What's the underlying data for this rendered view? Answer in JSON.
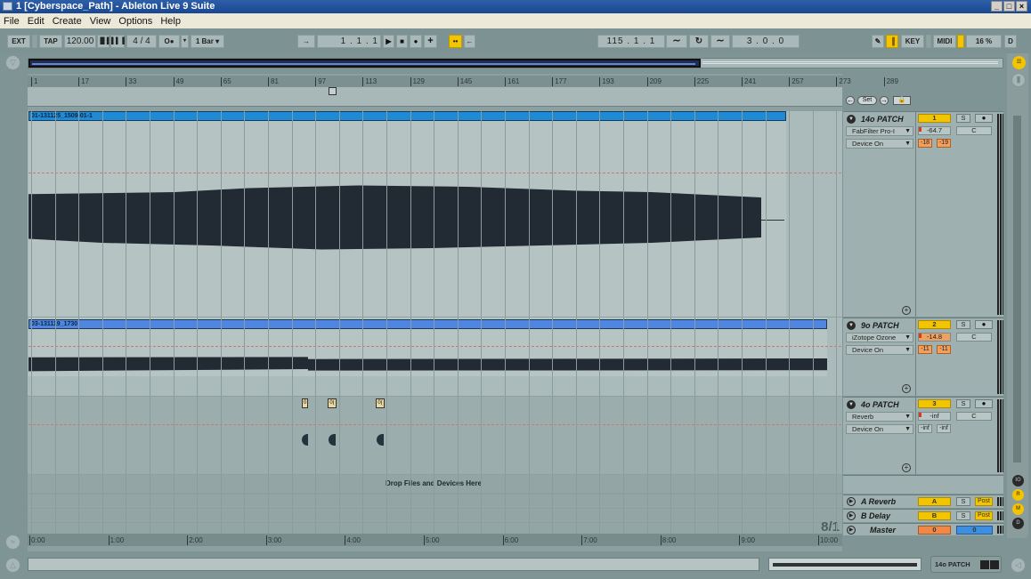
{
  "window": {
    "title": "1  [Cyberspace_Path] - Ableton Live 9 Suite",
    "controls": [
      "_",
      "□",
      "×"
    ]
  },
  "menu": [
    "File",
    "Edit",
    "Create",
    "View",
    "Options",
    "Help"
  ],
  "control_bar": {
    "ext": "EXT",
    "tap": "TAP",
    "tempo": "120.00",
    "nudge_down": "▐▌▌",
    "nudge_up": "▌▌▐",
    "time_signature": "4 / 4",
    "metronome": "O●",
    "quantize": "1 Bar",
    "follow": "→",
    "position": "1 .   1 .   1",
    "play": "▶",
    "stop": "■",
    "record": "●",
    "overdub": "+",
    "automation_arm": "••",
    "back_to_arrangement": "←",
    "loop_start": "115 .   1 .   1",
    "punch_in": "∼",
    "loop_toggle": "↻",
    "punch_out": "∼",
    "loop_length": "3 .   0 .   0",
    "draw_mode": "✎",
    "key_map_indicator": "▐",
    "key": "KEY",
    "midi": "MIDI",
    "cpu": "16 %",
    "disk": "D"
  },
  "ruler": {
    "bars": [
      "1",
      "17",
      "33",
      "49",
      "65",
      "81",
      "97",
      "113",
      "129",
      "145",
      "161",
      "177",
      "193",
      "209",
      "225",
      "241",
      "257",
      "273",
      "289"
    ],
    "set_label": "Set"
  },
  "tracks": [
    {
      "clip_name": "01-131125_1509-01-1",
      "clip_color": "#1f8ad6",
      "name": "14o PATCH",
      "number": "1",
      "solo": "S",
      "arm": "●",
      "device": "FabFilter Pro-I",
      "device_state": "Device On",
      "volume": "-64.7",
      "pan": "C",
      "peak_l": "-18",
      "peak_r": "-19"
    },
    {
      "clip_name": "03-131119_1730",
      "clip_color": "#4f86e0",
      "name": "9o PATCH",
      "number": "2",
      "solo": "S",
      "arm": "●",
      "device": "iZotope Ozone",
      "device_state": "Device On",
      "volume": "-14.8",
      "pan": "C",
      "peak_l": "-11",
      "peak_r": "-11"
    },
    {
      "clip_name": "",
      "name": "4o PATCH",
      "number": "3",
      "solo": "S",
      "arm": "●",
      "device": "Reverb",
      "device_state": "Device On",
      "volume": "-inf",
      "pan": "C",
      "peak_l": "-inf",
      "peak_r": "-inf",
      "small_clips": [
        "0",
        "0(",
        "0("
      ]
    }
  ],
  "drop_zone": "Drop Files and Devices Here",
  "return_tracks": [
    {
      "name": "A Reverb",
      "letter": "A",
      "solo": "S",
      "post": "Post"
    },
    {
      "name": "B Delay",
      "letter": "B",
      "solo": "S",
      "post": "Post"
    }
  ],
  "master": {
    "name": "Master",
    "volume": "0",
    "pan": "0",
    "time_sig": "8/1"
  },
  "time_ruler": [
    "0:00",
    "1:00",
    "2:00",
    "3:00",
    "4:00",
    "5:00",
    "6:00",
    "7:00",
    "8:00",
    "9:00",
    "10:00"
  ],
  "right_strip": {
    "io": "IO",
    "r": "R",
    "m": "M",
    "d": "D"
  },
  "status": {
    "text": "",
    "selected_track": "14o PATCH"
  },
  "colors": {
    "accent_yellow": "#f3c400",
    "master_orange": "#f0884a",
    "master_blue": "#3e8fe0"
  }
}
